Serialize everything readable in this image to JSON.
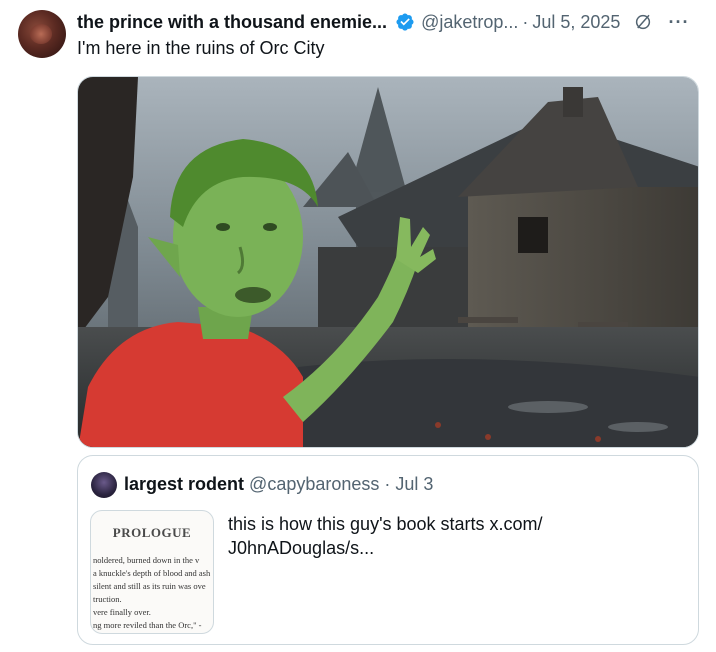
{
  "post": {
    "author_name": "the prince with a thousand enemie...",
    "handle": "@jaketrop...",
    "separator": "·",
    "date": "Jul 5, 2025",
    "more": "···",
    "text": "I'm here in the ruins of Orc City",
    "colors": {
      "verified": "#1d9bf0",
      "muted": "#536471",
      "text": "#0f1419"
    }
  },
  "quote": {
    "name": "largest rodent",
    "handle": "@capybaroness",
    "separator": "·",
    "date": "Jul 3",
    "text_line1": "this is how this guy's book starts  x.com/",
    "text_line2": "J0hnADouglas/s...",
    "thumbnail": {
      "title": "PROLOGUE",
      "lines": [
        "noldered, burned down in the v",
        "a knuckle's depth of blood and ash",
        " silent and still as its ruin was ove",
        "truction.",
        "vere finally over.",
        "ng more reviled than the Orc,\" -"
      ]
    }
  }
}
